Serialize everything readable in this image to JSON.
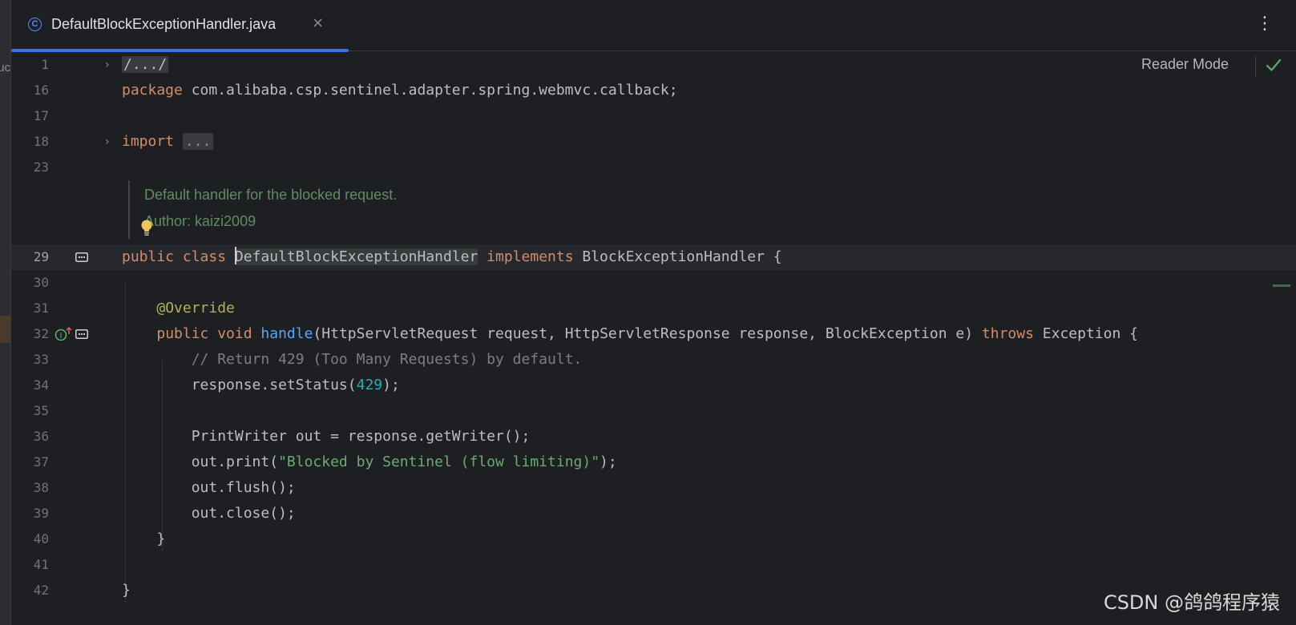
{
  "tab": {
    "title": "DefaultBlockExceptionHandler.java",
    "close": "×",
    "class_icon": "C"
  },
  "toolbar": {
    "more": "⋮",
    "reader_mode": "Reader Mode"
  },
  "left_strip": {
    "clip_text": "uc"
  },
  "doc": {
    "line1": "Default handler for the blocked request.",
    "line2": "Author: kaizi2009"
  },
  "lines": {
    "l1": {
      "num": "1",
      "folded": "/.../"
    },
    "l16": {
      "num": "16",
      "kw": "package",
      "rest": " com.alibaba.csp.sentinel.adapter.spring.webmvc.callback;"
    },
    "l17": {
      "num": "17"
    },
    "l18": {
      "num": "18",
      "kw": "import",
      "folded": "..."
    },
    "l23": {
      "num": "23"
    },
    "l29": {
      "num": "29",
      "kw": "public class",
      "name": "DefaultBlockExceptionHandler",
      "kw2": "implements",
      "rest": " BlockExceptionHandler {"
    },
    "l30": {
      "num": "30"
    },
    "l31": {
      "num": "31",
      "ann": "@Override"
    },
    "l32": {
      "num": "32",
      "kw": "public void",
      "fn": "handle",
      "mid": "(HttpServletRequest request, HttpServletResponse response, BlockException e) ",
      "kw2": "throws",
      "rest": " Exception {"
    },
    "l33": {
      "num": "33",
      "cmt": "// Return 429 (Too Many Requests) by default."
    },
    "l34": {
      "num": "34",
      "pre": "response.setStatus(",
      "number": "429",
      "post": ");"
    },
    "l35": {
      "num": "35"
    },
    "l36": {
      "num": "36",
      "text": "PrintWriter out = response.getWriter();"
    },
    "l37": {
      "num": "37",
      "pre": "out.print(",
      "str": "\"Blocked by Sentinel (flow limiting)\"",
      "post": ");"
    },
    "l38": {
      "num": "38",
      "text": "out.flush();"
    },
    "l39": {
      "num": "39",
      "text": "out.close();"
    },
    "l40": {
      "num": "40",
      "text": "}"
    },
    "l41": {
      "num": "41"
    },
    "l42": {
      "num": "42",
      "text": "}"
    }
  },
  "watermark": "CSDN @鸽鸽程序猿",
  "colors": {
    "background": "#1e1f22",
    "keyword": "#cf8e6d",
    "function": "#56a8f5",
    "number": "#2aacb8",
    "string": "#6aab73",
    "comment": "#7a7e85",
    "annotation": "#b3ae60",
    "tab_underline": "#3574f0",
    "doc_comment": "#5f8c63"
  }
}
